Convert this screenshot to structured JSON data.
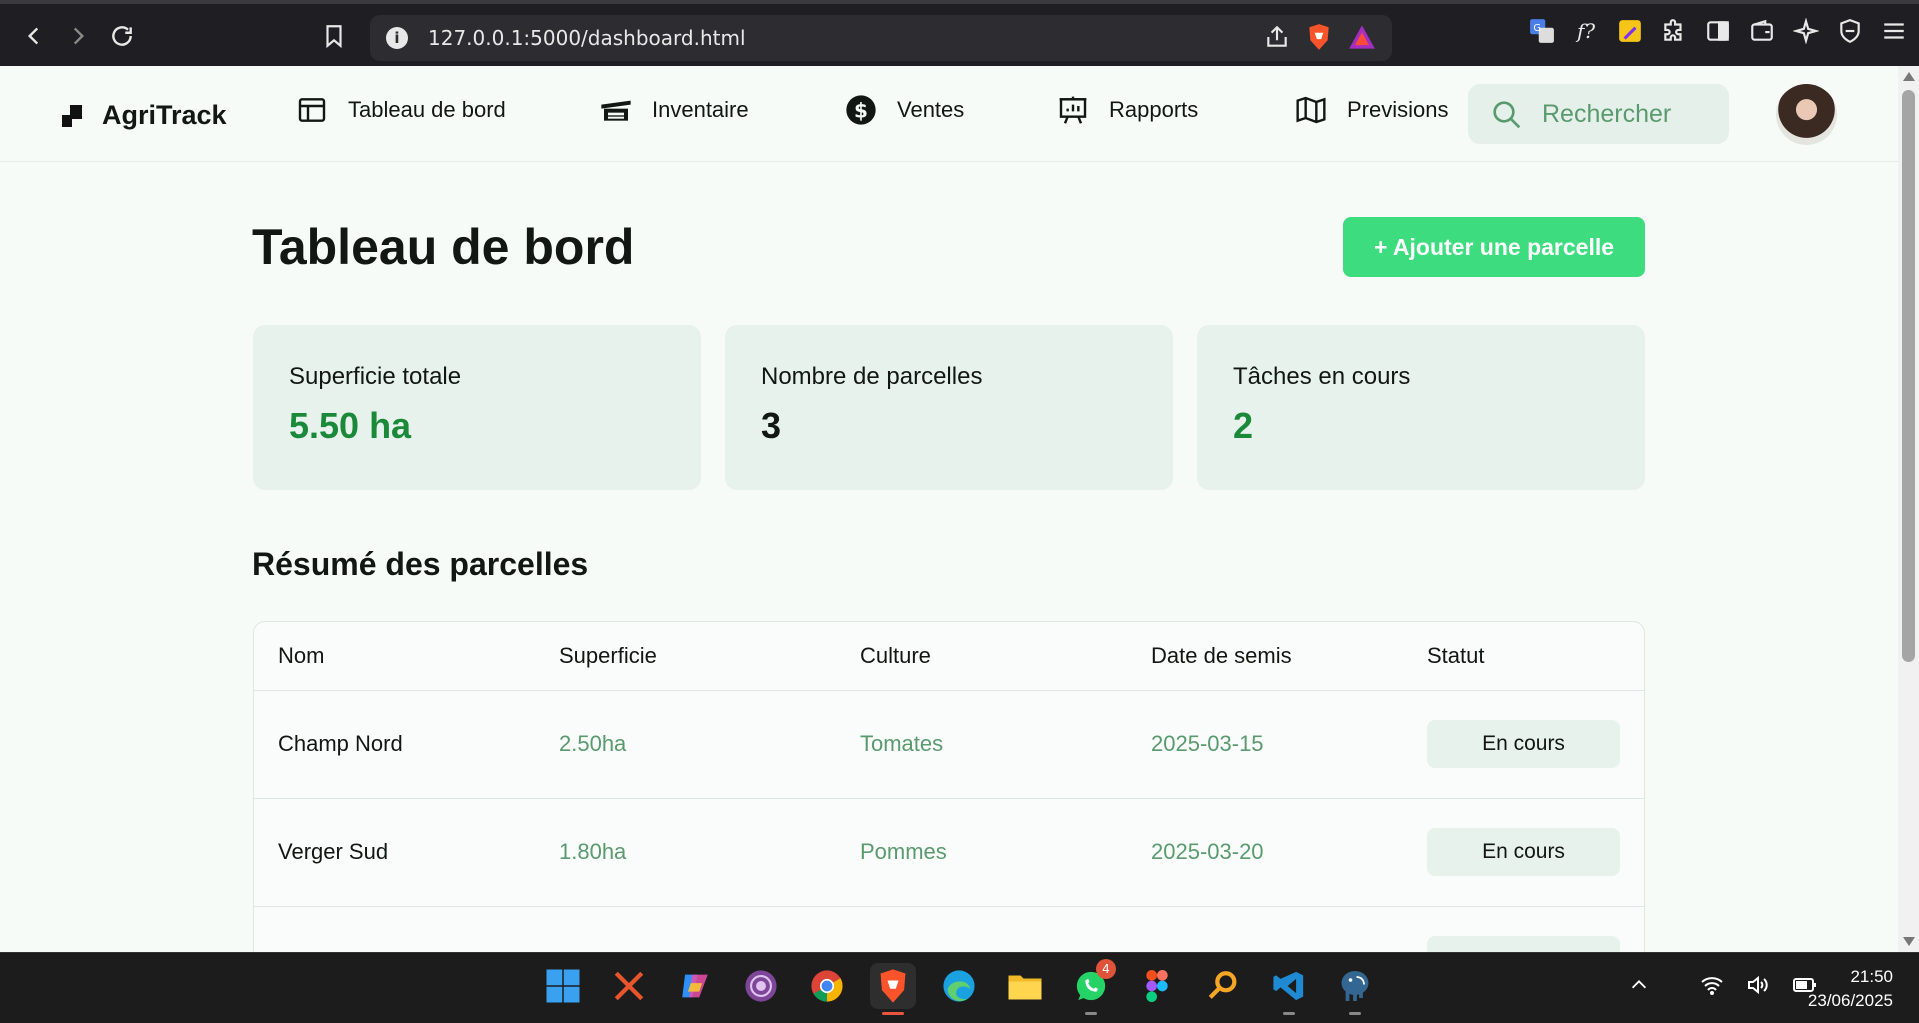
{
  "browser": {
    "url": "127.0.0.1:5000/dashboard.html"
  },
  "app": {
    "brand": "AgriTrack",
    "nav": [
      {
        "label": "Tableau de bord",
        "icon": "layout-icon"
      },
      {
        "label": "Inventaire",
        "icon": "warehouse-icon"
      },
      {
        "label": "Ventes",
        "icon": "dollar-circle-icon"
      },
      {
        "label": "Rapports",
        "icon": "presentation-chart-icon"
      },
      {
        "label": "Previsions",
        "icon": "map-icon"
      }
    ],
    "search_placeholder": "Rechercher"
  },
  "main": {
    "title": "Tableau de bord",
    "add_button": "+ Ajouter une parcelle",
    "stats": [
      {
        "label": "Superficie totale",
        "value": "5.50 ha",
        "color": "#1a8a3a"
      },
      {
        "label": "Nombre de parcelles",
        "value": "3",
        "color": "#121714"
      },
      {
        "label": "Tâches en cours",
        "value": "2",
        "color": "#1a8a3a"
      }
    ],
    "section_title": "Résumé des parcelles",
    "table": {
      "headers": [
        "Nom",
        "Superficie",
        "Culture",
        "Date de semis",
        "Statut"
      ],
      "rows": [
        {
          "name": "Champ Nord",
          "area": "2.50ha",
          "crop": "Tomates",
          "date": "2025-03-15",
          "status": "En cours"
        },
        {
          "name": "Verger Sud",
          "area": "1.80ha",
          "crop": "Pommes",
          "date": "2025-03-20",
          "status": "En cours"
        }
      ]
    }
  },
  "taskbar": {
    "whatsapp_badge": "4",
    "time": "21:50",
    "date": "23/06/2025"
  },
  "colors": {
    "accent": "#3ddc7e",
    "card_bg": "#e7f2ec",
    "muted_green": "#5a9a6f"
  }
}
